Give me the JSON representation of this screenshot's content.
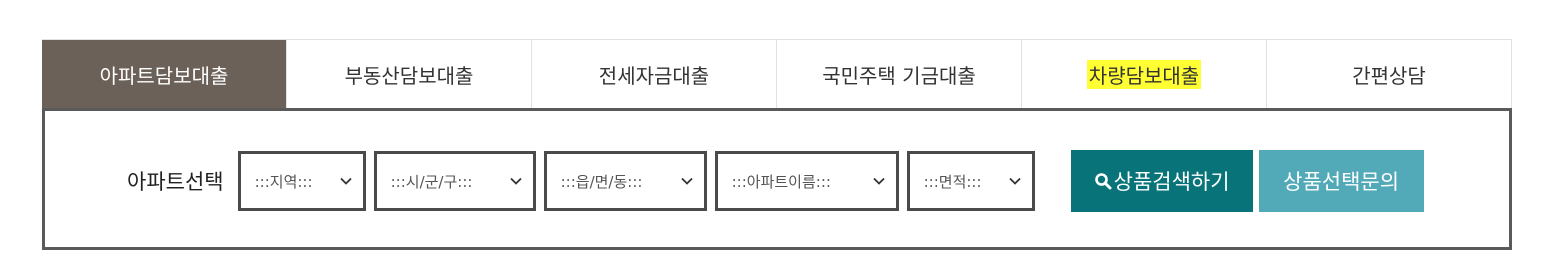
{
  "tabs": [
    {
      "label": "아파트담보대출",
      "active": true
    },
    {
      "label": "부동산담보대출"
    },
    {
      "label": "전세자금대출"
    },
    {
      "label": "국민주택 기금대출"
    },
    {
      "label": "차량담보대출",
      "highlighted": true
    },
    {
      "label": "간편상담"
    }
  ],
  "search": {
    "label": "아파트선택",
    "region": ":::지역:::",
    "city": ":::시/군/구:::",
    "town": ":::읍/면/동:::",
    "apartment": ":::아파트이름:::",
    "area": ":::면적:::",
    "search_button": "상품검색하기",
    "inquiry_button": "상품선택문의"
  },
  "colors": {
    "active_tab": "#6b6158",
    "highlight": "#ffff33",
    "search_button": "#087378",
    "inquiry_button": "#52a9b8",
    "panel_border": "#5a5a5a"
  }
}
